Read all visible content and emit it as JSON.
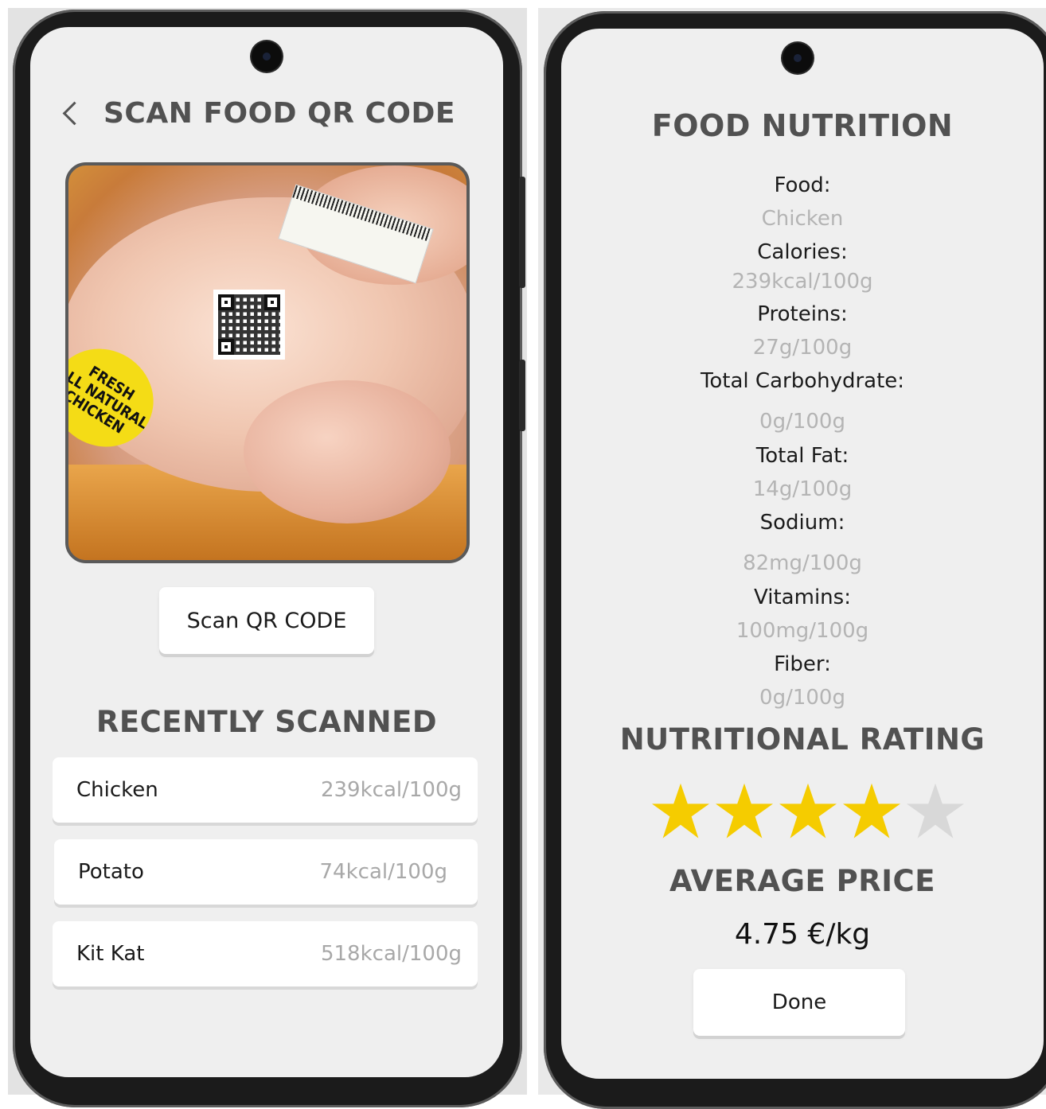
{
  "scan_screen": {
    "title": "SCAN FOOD QR CODE",
    "sticker_lines": [
      "FRESH",
      "ALL NATURAL",
      "CHICKEN"
    ],
    "scan_button": "Scan QR CODE",
    "recent_title": "RECENTLY SCANNED",
    "recent_items": [
      {
        "name": "Chicken",
        "kcal": "239kcal/100g"
      },
      {
        "name": "Potato",
        "kcal": "74kcal/100g"
      },
      {
        "name": "Kit Kat",
        "kcal": "518kcal/100g"
      }
    ]
  },
  "nutrition_screen": {
    "title": "FOOD NUTRITION",
    "facts": [
      {
        "label": "Food:",
        "value": "Chicken"
      },
      {
        "label": "Calories:",
        "value": "239kcal/100g"
      },
      {
        "label": "Proteins:",
        "value": "27g/100g"
      },
      {
        "label": "Total Carbohydrate:",
        "value": "0g/100g"
      },
      {
        "label": "Total Fat:",
        "value": "14g/100g"
      },
      {
        "label": "Sodium:",
        "value": "82mg/100g"
      },
      {
        "label": "Vitamins:",
        "value": "100mg/100g"
      },
      {
        "label": "Fiber:",
        "value": "0g/100g"
      }
    ],
    "rating_title": "NUTRITIONAL RATING",
    "rating": {
      "value": 4,
      "max": 5
    },
    "price_title": "AVERAGE PRICE",
    "price": "4.75 €/kg",
    "done_button": "Done"
  },
  "colors": {
    "star_filled": "#f5cc00",
    "star_empty": "#d8d8d8",
    "heading": "#515151",
    "muted_text": "#a8a8a8"
  }
}
